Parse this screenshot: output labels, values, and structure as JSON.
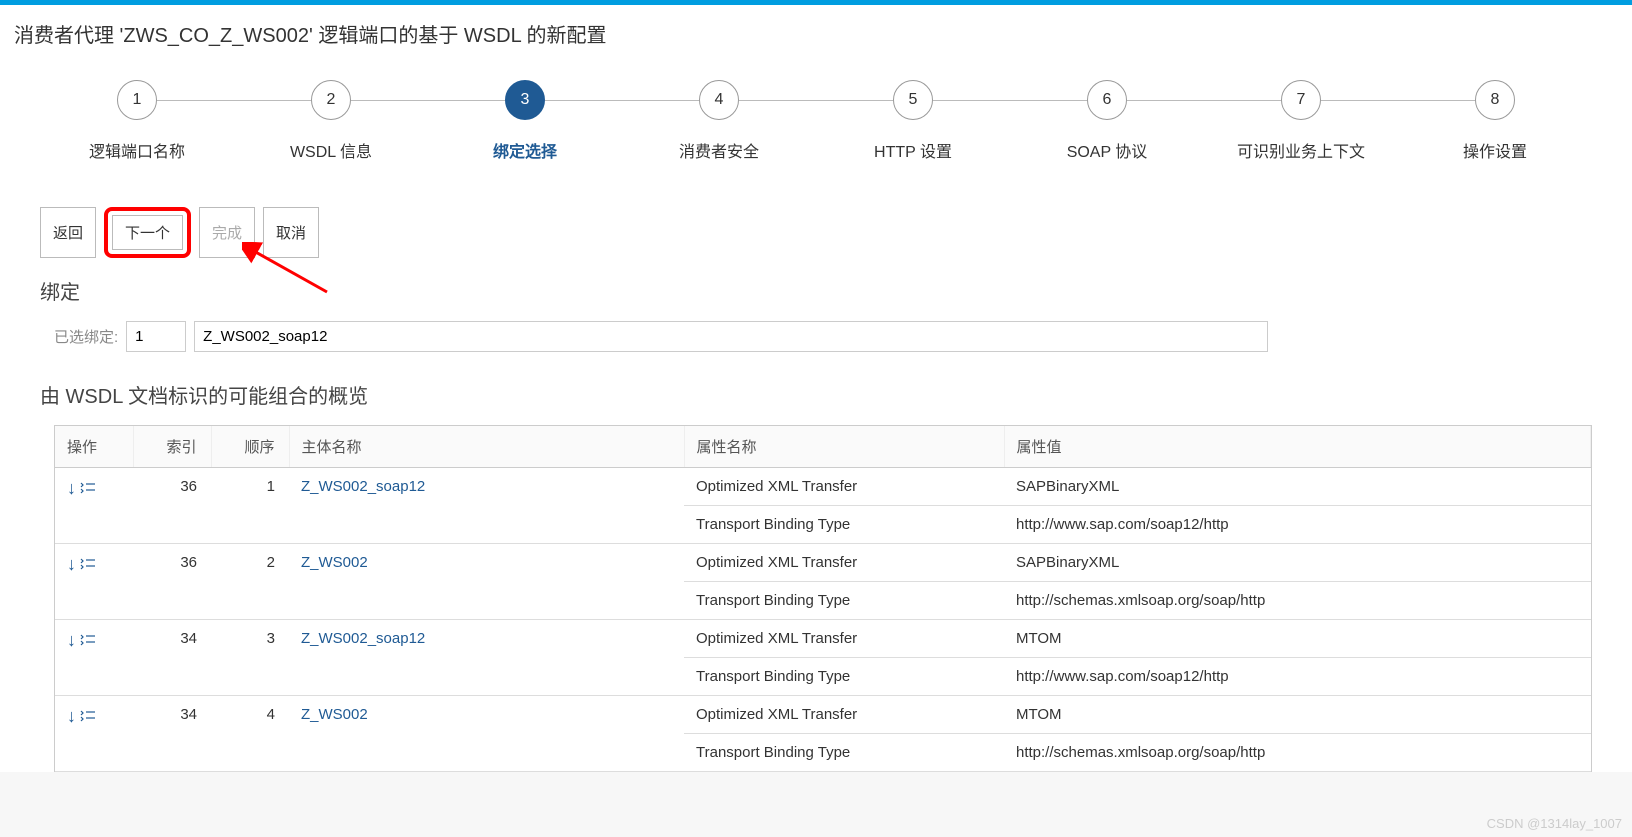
{
  "header": {
    "title": "消费者代理 'ZWS_CO_Z_WS002' 逻辑端口的基于 WSDL 的新配置"
  },
  "stepper": {
    "steps": [
      {
        "num": "1",
        "label": "逻辑端口名称"
      },
      {
        "num": "2",
        "label": "WSDL 信息"
      },
      {
        "num": "3",
        "label": "绑定选择"
      },
      {
        "num": "4",
        "label": "消费者安全"
      },
      {
        "num": "5",
        "label": "HTTP 设置"
      },
      {
        "num": "6",
        "label": "SOAP 协议"
      },
      {
        "num": "7",
        "label": "可识别业务上下文"
      },
      {
        "num": "8",
        "label": "操作设置"
      }
    ],
    "activeIndex": 2
  },
  "buttons": {
    "back": "返回",
    "next": "下一个",
    "finish": "完成",
    "cancel": "取消"
  },
  "binding": {
    "section_title": "绑定",
    "selected_label": "已选绑定:",
    "selected_index": "1",
    "selected_name": "Z_WS002_soap12"
  },
  "overview": {
    "title": "由 WSDL 文档标识的可能组合的概览"
  },
  "table": {
    "headers": {
      "action": "操作",
      "index": "索引",
      "order": "顺序",
      "subject": "主体名称",
      "attrname": "属性名称",
      "attrval": "属性值"
    },
    "rows": [
      {
        "index": "36",
        "order": "1",
        "subject": "Z_WS002_soap12",
        "attrs": [
          {
            "name": "Optimized XML Transfer",
            "val": "SAPBinaryXML"
          },
          {
            "name": "Transport Binding Type",
            "val": "http://www.sap.com/soap12/http"
          }
        ]
      },
      {
        "index": "36",
        "order": "2",
        "subject": "Z_WS002",
        "attrs": [
          {
            "name": "Optimized XML Transfer",
            "val": "SAPBinaryXML"
          },
          {
            "name": "Transport Binding Type",
            "val": "http://schemas.xmlsoap.org/soap/http"
          }
        ]
      },
      {
        "index": "34",
        "order": "3",
        "subject": "Z_WS002_soap12",
        "attrs": [
          {
            "name": "Optimized XML Transfer",
            "val": "MTOM"
          },
          {
            "name": "Transport Binding Type",
            "val": "http://www.sap.com/soap12/http"
          }
        ]
      },
      {
        "index": "34",
        "order": "4",
        "subject": "Z_WS002",
        "attrs": [
          {
            "name": "Optimized XML Transfer",
            "val": "MTOM"
          },
          {
            "name": "Transport Binding Type",
            "val": "http://schemas.xmlsoap.org/soap/http"
          }
        ]
      }
    ]
  },
  "watermark": "CSDN @1314lay_1007"
}
